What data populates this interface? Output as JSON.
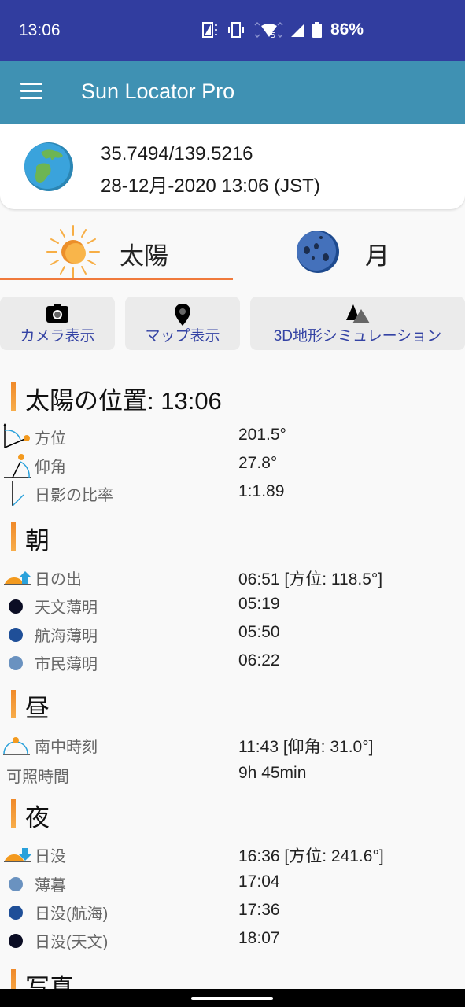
{
  "status_bar": {
    "time": "13:06",
    "battery_percent": "86%",
    "icons": [
      "screen-rotate-icon",
      "vibrate-icon",
      "wifi-icon",
      "signal-icon",
      "battery-icon"
    ],
    "wifi_badge": "5"
  },
  "app_bar": {
    "title": "Sun Locator Pro",
    "menu_icon": "hamburger-menu-icon"
  },
  "location": {
    "coords": "35.7494/139.5216",
    "datetime": "28-12月-2020 13:06 (JST)",
    "icon": "globe-icon"
  },
  "tabs": [
    {
      "label": "太陽",
      "icon": "sun-icon",
      "active": true
    },
    {
      "label": "月",
      "icon": "moon-icon",
      "active": false
    }
  ],
  "actions": [
    {
      "label": "カメラ表示",
      "icon": "camera-icon"
    },
    {
      "label": "マップ表示",
      "icon": "map-pin-icon"
    },
    {
      "label": "3D地形シミュレーション",
      "icon": "mountain-icon"
    }
  ],
  "position": {
    "title": "太陽の位置: 13:06",
    "rows": [
      {
        "label": "方位",
        "value": "201.5°",
        "icon": "azimuth-icon"
      },
      {
        "label": "仰角",
        "value": "27.8°",
        "icon": "elevation-icon"
      },
      {
        "label": "日影の比率",
        "value": "1:1.89",
        "icon": "shadow-ratio-icon"
      }
    ]
  },
  "morning": {
    "title": "朝",
    "rows": [
      {
        "label": "日の出",
        "value": "06:51 [方位: 118.5°]",
        "icon": "sunrise-icon"
      },
      {
        "label": "天文薄明",
        "value": "05:19",
        "icon": "astronomical-dot-icon",
        "color": "#0b0d24"
      },
      {
        "label": "航海薄明",
        "value": "05:50",
        "icon": "nautical-dot-icon",
        "color": "#1f4f98"
      },
      {
        "label": "市民薄明",
        "value": "06:22",
        "icon": "civil-dot-icon",
        "color": "#6a92c0"
      }
    ]
  },
  "noon": {
    "title": "昼",
    "rows": [
      {
        "label": "南中時刻",
        "value": "11:43 [仰角: 31.0°]",
        "icon": "solar-noon-icon"
      },
      {
        "label": "可照時間",
        "value": "9h 45min"
      }
    ]
  },
  "night": {
    "title": "夜",
    "rows": [
      {
        "label": "日没",
        "value": "16:36 [方位: 241.6°]",
        "icon": "sunset-icon"
      },
      {
        "label": "薄暮",
        "value": "17:04",
        "icon": "civil-dot-icon",
        "color": "#6a92c0"
      },
      {
        "label": "日没(航海)",
        "value": "17:36",
        "icon": "nautical-dot-icon",
        "color": "#1f4f98"
      },
      {
        "label": "日没(天文)",
        "value": "18:07",
        "icon": "astronomical-dot-icon",
        "color": "#0b0d24"
      }
    ]
  },
  "photo": {
    "title": "写真"
  },
  "colors": {
    "status_bar": "#313d9f",
    "app_bar": "#3f91b3",
    "tab_indicator": "#f07a3c",
    "action_text": "#3443a4",
    "section_accent": "#f08a2a"
  }
}
